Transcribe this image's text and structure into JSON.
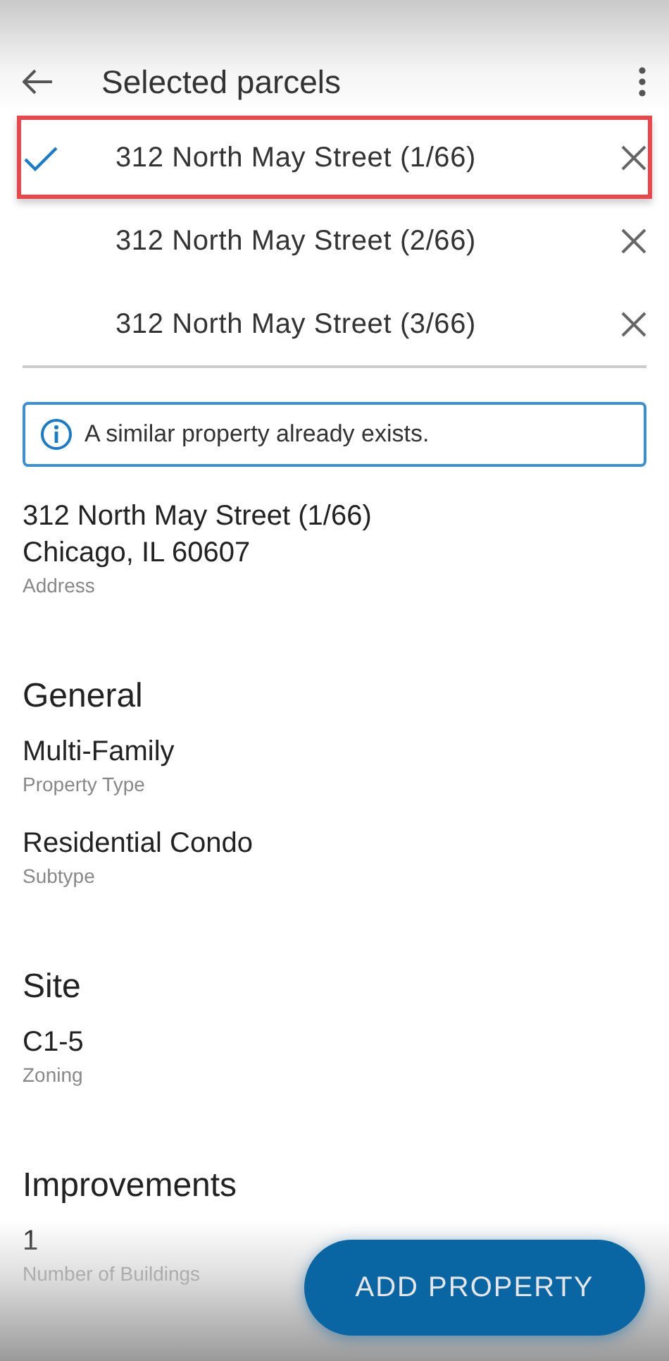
{
  "header": {
    "title": "Selected parcels"
  },
  "parcels": [
    {
      "label": "312 North May Street (1/66)",
      "selected": true
    },
    {
      "label": "312 North May Street (2/66)",
      "selected": false
    },
    {
      "label": "312 North May Street (3/66)",
      "selected": false
    }
  ],
  "notice": {
    "text": "A similar property already exists."
  },
  "sections": [
    {
      "fields": [
        {
          "lines": [
            "312 North May Street (1/66)",
            "Chicago, IL 60607"
          ],
          "label": "Address"
        }
      ]
    },
    {
      "heading": "General",
      "fields": [
        {
          "lines": [
            "Multi-Family"
          ],
          "label": "Property Type"
        },
        {
          "lines": [
            "Residential Condo"
          ],
          "label": "Subtype"
        }
      ]
    },
    {
      "heading": "Site",
      "fields": [
        {
          "lines": [
            "C1-5"
          ],
          "label": "Zoning"
        }
      ]
    },
    {
      "heading": "Improvements",
      "fields": [
        {
          "lines": [
            "1"
          ],
          "label": "Number of Buildings"
        }
      ]
    }
  ],
  "action": {
    "label": "ADD PROPERTY"
  }
}
